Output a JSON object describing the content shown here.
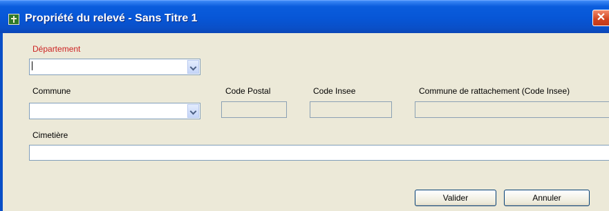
{
  "window": {
    "title": "Propriété du relevé - Sans Titre 1",
    "close_glyph": "✕"
  },
  "form": {
    "departement": {
      "label": "Département",
      "value": ""
    },
    "commune": {
      "label": "Commune",
      "value": ""
    },
    "code_postal": {
      "label": "Code Postal",
      "value": ""
    },
    "code_insee": {
      "label": "Code Insee",
      "value": ""
    },
    "commune_rattachement": {
      "label": "Commune de rattachement (Code Insee)",
      "value": ""
    },
    "cimetiere": {
      "label": "Cimetière",
      "value": ""
    }
  },
  "buttons": {
    "valider": "Valider",
    "annuler": "Annuler"
  },
  "colors": {
    "titlebar": "#0756d6",
    "required_label": "#cc2222",
    "dialog_bg": "#ece9d8"
  }
}
